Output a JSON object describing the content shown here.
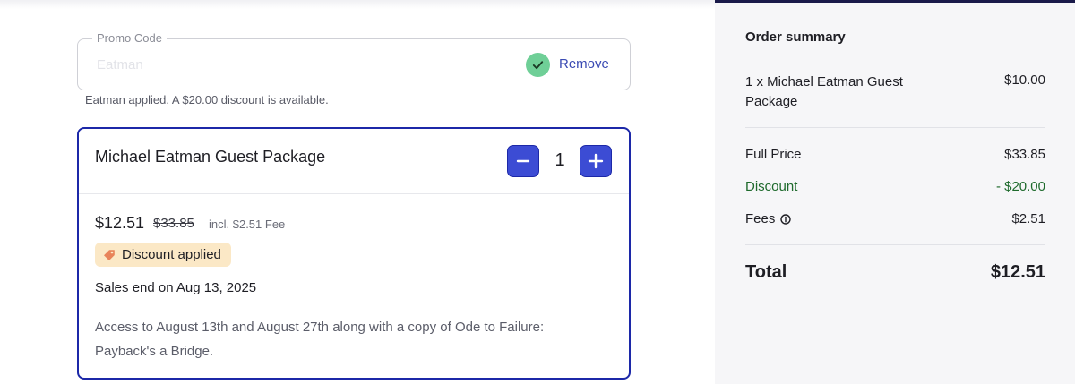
{
  "promo": {
    "legend": "Promo Code",
    "value": "Eatman",
    "remove_label": "Remove",
    "message": "Eatman applied. A $20.00 discount is available."
  },
  "ticket": {
    "name": "Michael Eatman Guest Package",
    "quantity": "1",
    "price_now": "$12.51",
    "price_original": "$33.85",
    "fee_note": "incl. $2.51 Fee",
    "badge": "Discount applied",
    "sales_end": "Sales end on Aug 13, 2025",
    "description": "Access to August 13th and August 27th along with a copy of Ode to Failure: Payback's a Bridge."
  },
  "summary": {
    "title": "Order summary",
    "item_name": "1 x Michael Eatman Guest Package",
    "item_price": "$10.00",
    "full_price_label": "Full Price",
    "full_price_value": "$33.85",
    "discount_label": "Discount",
    "discount_value": "- $20.00",
    "fees_label": "Fees",
    "fees_value": "$2.51",
    "total_label": "Total",
    "total_value": "$12.51"
  },
  "colors": {
    "accent": "#3c4cd4",
    "accent_border": "#1c28a8",
    "success": "#6fcf97",
    "discount_text": "#1e6a2c",
    "badge_bg": "#fbe8c6"
  },
  "icons": {
    "promo_status": "check-icon",
    "decrement": "minus-icon",
    "increment": "plus-icon",
    "badge": "tag-icon",
    "fees_info": "info-icon"
  }
}
